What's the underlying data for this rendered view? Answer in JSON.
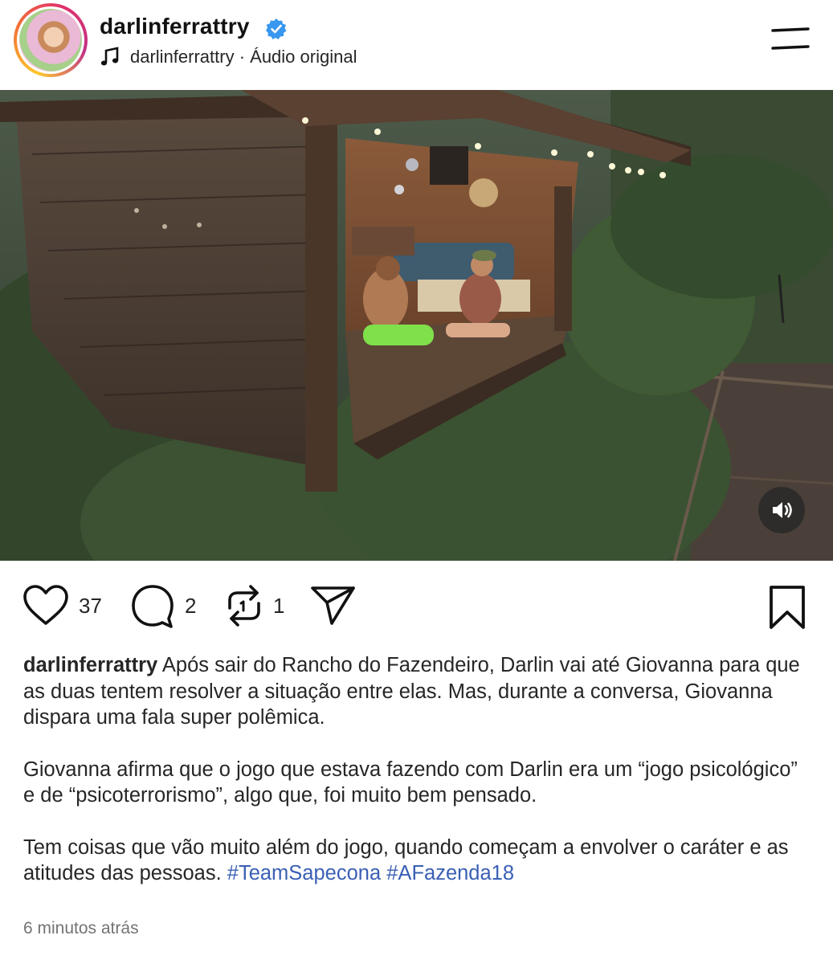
{
  "header": {
    "username": "darlinferrattry",
    "audio_label": "darlinferrattry · Áudio original",
    "verified_icon": "verified-badge-icon",
    "music_icon": "music-note-icon",
    "menu_icon": "menu-icon"
  },
  "video": {
    "sound_icon": "speaker-icon"
  },
  "actions": {
    "likes": "37",
    "comments": "2",
    "reposts": "1"
  },
  "caption": {
    "username": "darlinferrattry",
    "p1": "Após sair do Rancho do Fazendeiro, Darlin vai até Giovanna para que as duas tentem resolver a situação entre elas. Mas, durante a conversa, Giovanna dispara uma fala super polêmica.",
    "p2": "Giovanna afirma que o jogo que estava fazendo com Darlin era um “jogo psicológico” e de “psicoterrorismo”, algo que, foi muito bem pensado.",
    "p3": "Tem coisas que vão muito além do jogo, quando começam a envolver o caráter e as atitudes das pessoas.",
    "hashtag1": "#TeamSapecona",
    "hashtag2": "#AFazenda18"
  },
  "timestamp": "6 minutos atrás",
  "colors": {
    "text": "#262626",
    "secondary": "#737373",
    "link": "#3a5fb5",
    "verified": "#3897f0"
  }
}
